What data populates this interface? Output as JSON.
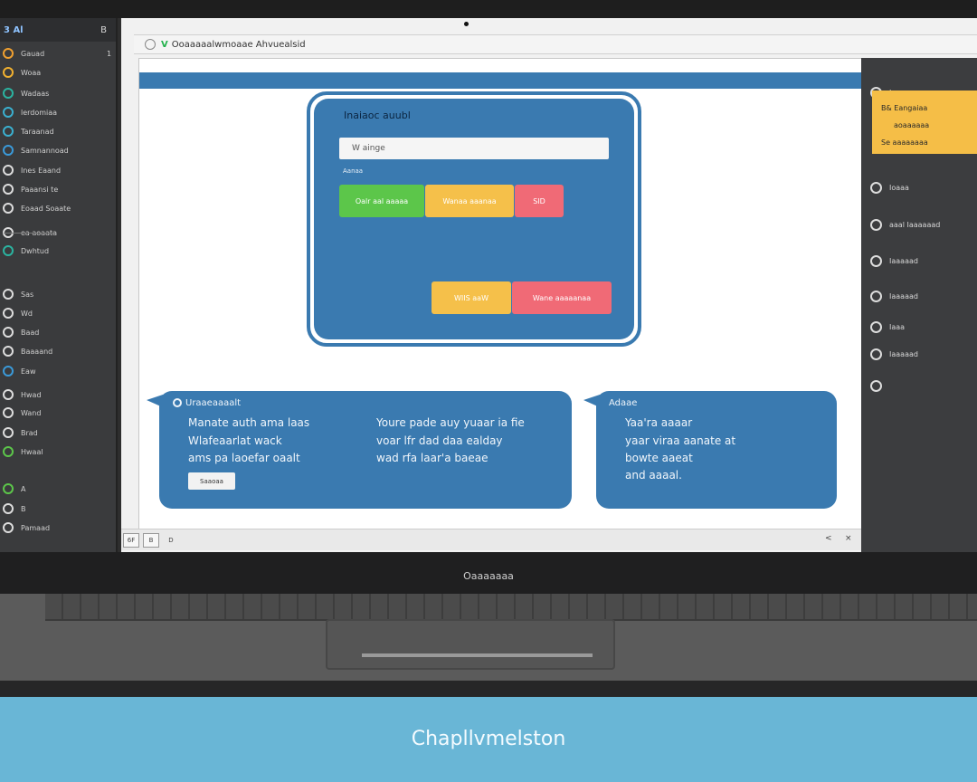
{
  "sidebar": {
    "header_label": "3 Al",
    "header_count": "B",
    "items": [
      {
        "label": "Gauad",
        "count": "1",
        "icon": "info-icon",
        "color": "#f0a030"
      },
      {
        "label": "Woaa",
        "count": "",
        "icon": "star-icon",
        "color": "#f0b030"
      },
      {
        "label": "Wadaas",
        "count": "",
        "icon": "bookmark-icon",
        "color": "#2bb3a0"
      },
      {
        "label": "lerdomiaa",
        "count": "",
        "icon": "tag-icon",
        "color": "#3ab0d0"
      },
      {
        "label": "Taraanad",
        "count": "",
        "icon": "folder-icon",
        "color": "#3ab0d0"
      },
      {
        "label": "Samnannoad",
        "count": "",
        "icon": "clock-icon",
        "color": "#3a9ad9"
      },
      {
        "label": "Ines Eaand",
        "count": "",
        "icon": "document-icon",
        "color": "#dddddd"
      },
      {
        "label": "Paaansi te",
        "count": "",
        "icon": "flag-icon",
        "color": "#dddddd"
      },
      {
        "label": "Eoaad Soaate",
        "count": "",
        "icon": "user-icon",
        "color": "#dddddd"
      },
      {
        "label": "ea aoaata",
        "count": "",
        "icon": "eye-icon",
        "color": "#dddddd"
      },
      {
        "label": "Dwhtud",
        "count": "",
        "icon": "settings-icon",
        "color": "#2bb3a0"
      },
      {
        "label": "Sas",
        "count": "",
        "icon": "share-icon",
        "color": "#dddddd"
      },
      {
        "label": "Wd",
        "count": "",
        "icon": "link-icon",
        "color": "#dddddd"
      },
      {
        "label": "Baad",
        "count": "",
        "icon": "chat-icon",
        "color": "#dddddd"
      },
      {
        "label": "Baaaand",
        "count": "",
        "icon": "cloud-icon",
        "color": "#dddddd"
      },
      {
        "label": "Eaw",
        "count": "",
        "icon": "grid-icon",
        "color": "#3a9ad9"
      },
      {
        "label": "Hwad",
        "count": "",
        "icon": "mail-icon",
        "color": "#dddddd"
      },
      {
        "label": "Wand",
        "count": "",
        "icon": "phone-icon",
        "color": "#dddddd"
      },
      {
        "label": "Brad",
        "count": "",
        "icon": "camera-icon",
        "color": "#dddddd"
      },
      {
        "label": "Hwaal",
        "count": "",
        "icon": "lock-icon",
        "color": "#5cc64a"
      },
      {
        "label": "A",
        "count": "",
        "icon": "triangle-icon",
        "color": "#5cc64a"
      },
      {
        "label": "B",
        "count": "",
        "icon": "circle-icon",
        "color": "#dddddd"
      },
      {
        "label": "Pamaad",
        "count": "",
        "icon": "power-icon",
        "color": "#dddddd"
      }
    ]
  },
  "browser": {
    "ssl_mark": "V",
    "address_text": "Ooaaaaalwmoaae Ahvuealsid"
  },
  "dialog": {
    "title": "Inaiaoc auubl",
    "input_value": "W ainge",
    "hint": "Aanaa",
    "buttons": {
      "green": "Oalr aal aaaaa",
      "yellow": "Wanaa aaanaa",
      "red": "SID",
      "yellow2": "WIIS aaW",
      "red2": "Wane aaaaanaa"
    }
  },
  "bubble_left": {
    "title": "Uraaeaaaalt",
    "col1": [
      "Manate auth ama laas",
      "Wlafeaarlat wack",
      "ams pa laoefar oaalt"
    ],
    "col2": [
      "Youre pade auy yuaar ia fie",
      "voar lfr dad daa ealday",
      "wad rfa laar'a baeae"
    ],
    "button": "Saaoaa"
  },
  "bubble_right": {
    "title": "Adaae",
    "lines": [
      "Yaa'ra aaaar",
      "yaar viraa aanate at",
      "bowte aaeat",
      "and aaaal."
    ]
  },
  "right_panel": {
    "items": [
      {
        "label": "Iaaaa",
        "icon": "globe-icon"
      },
      {
        "label": "Ioaaa",
        "icon": "search-icon"
      },
      {
        "label": "aaal Iaaaaaad",
        "icon": "users-icon"
      },
      {
        "label": "Iaaaaad",
        "icon": "cloud-icon"
      },
      {
        "label": "Iaaaaad",
        "icon": "chat-icon"
      },
      {
        "label": "Iaaa",
        "icon": "refresh-icon"
      },
      {
        "label": "Iaaaaad",
        "icon": "bell-icon"
      },
      {
        "label": "",
        "icon": "settings-icon"
      }
    ],
    "note_lines": [
      "B& Eangaiaa",
      "aoaaaaaa",
      "Se aaaaaaaa"
    ]
  },
  "status_bar": {
    "left_buttons": [
      "6F",
      "B",
      "D"
    ],
    "right_controls": [
      "<",
      "×"
    ]
  },
  "laptop": {
    "brand": "Oaaaaaaa"
  },
  "footer": {
    "title": "Chapllvmelston"
  }
}
